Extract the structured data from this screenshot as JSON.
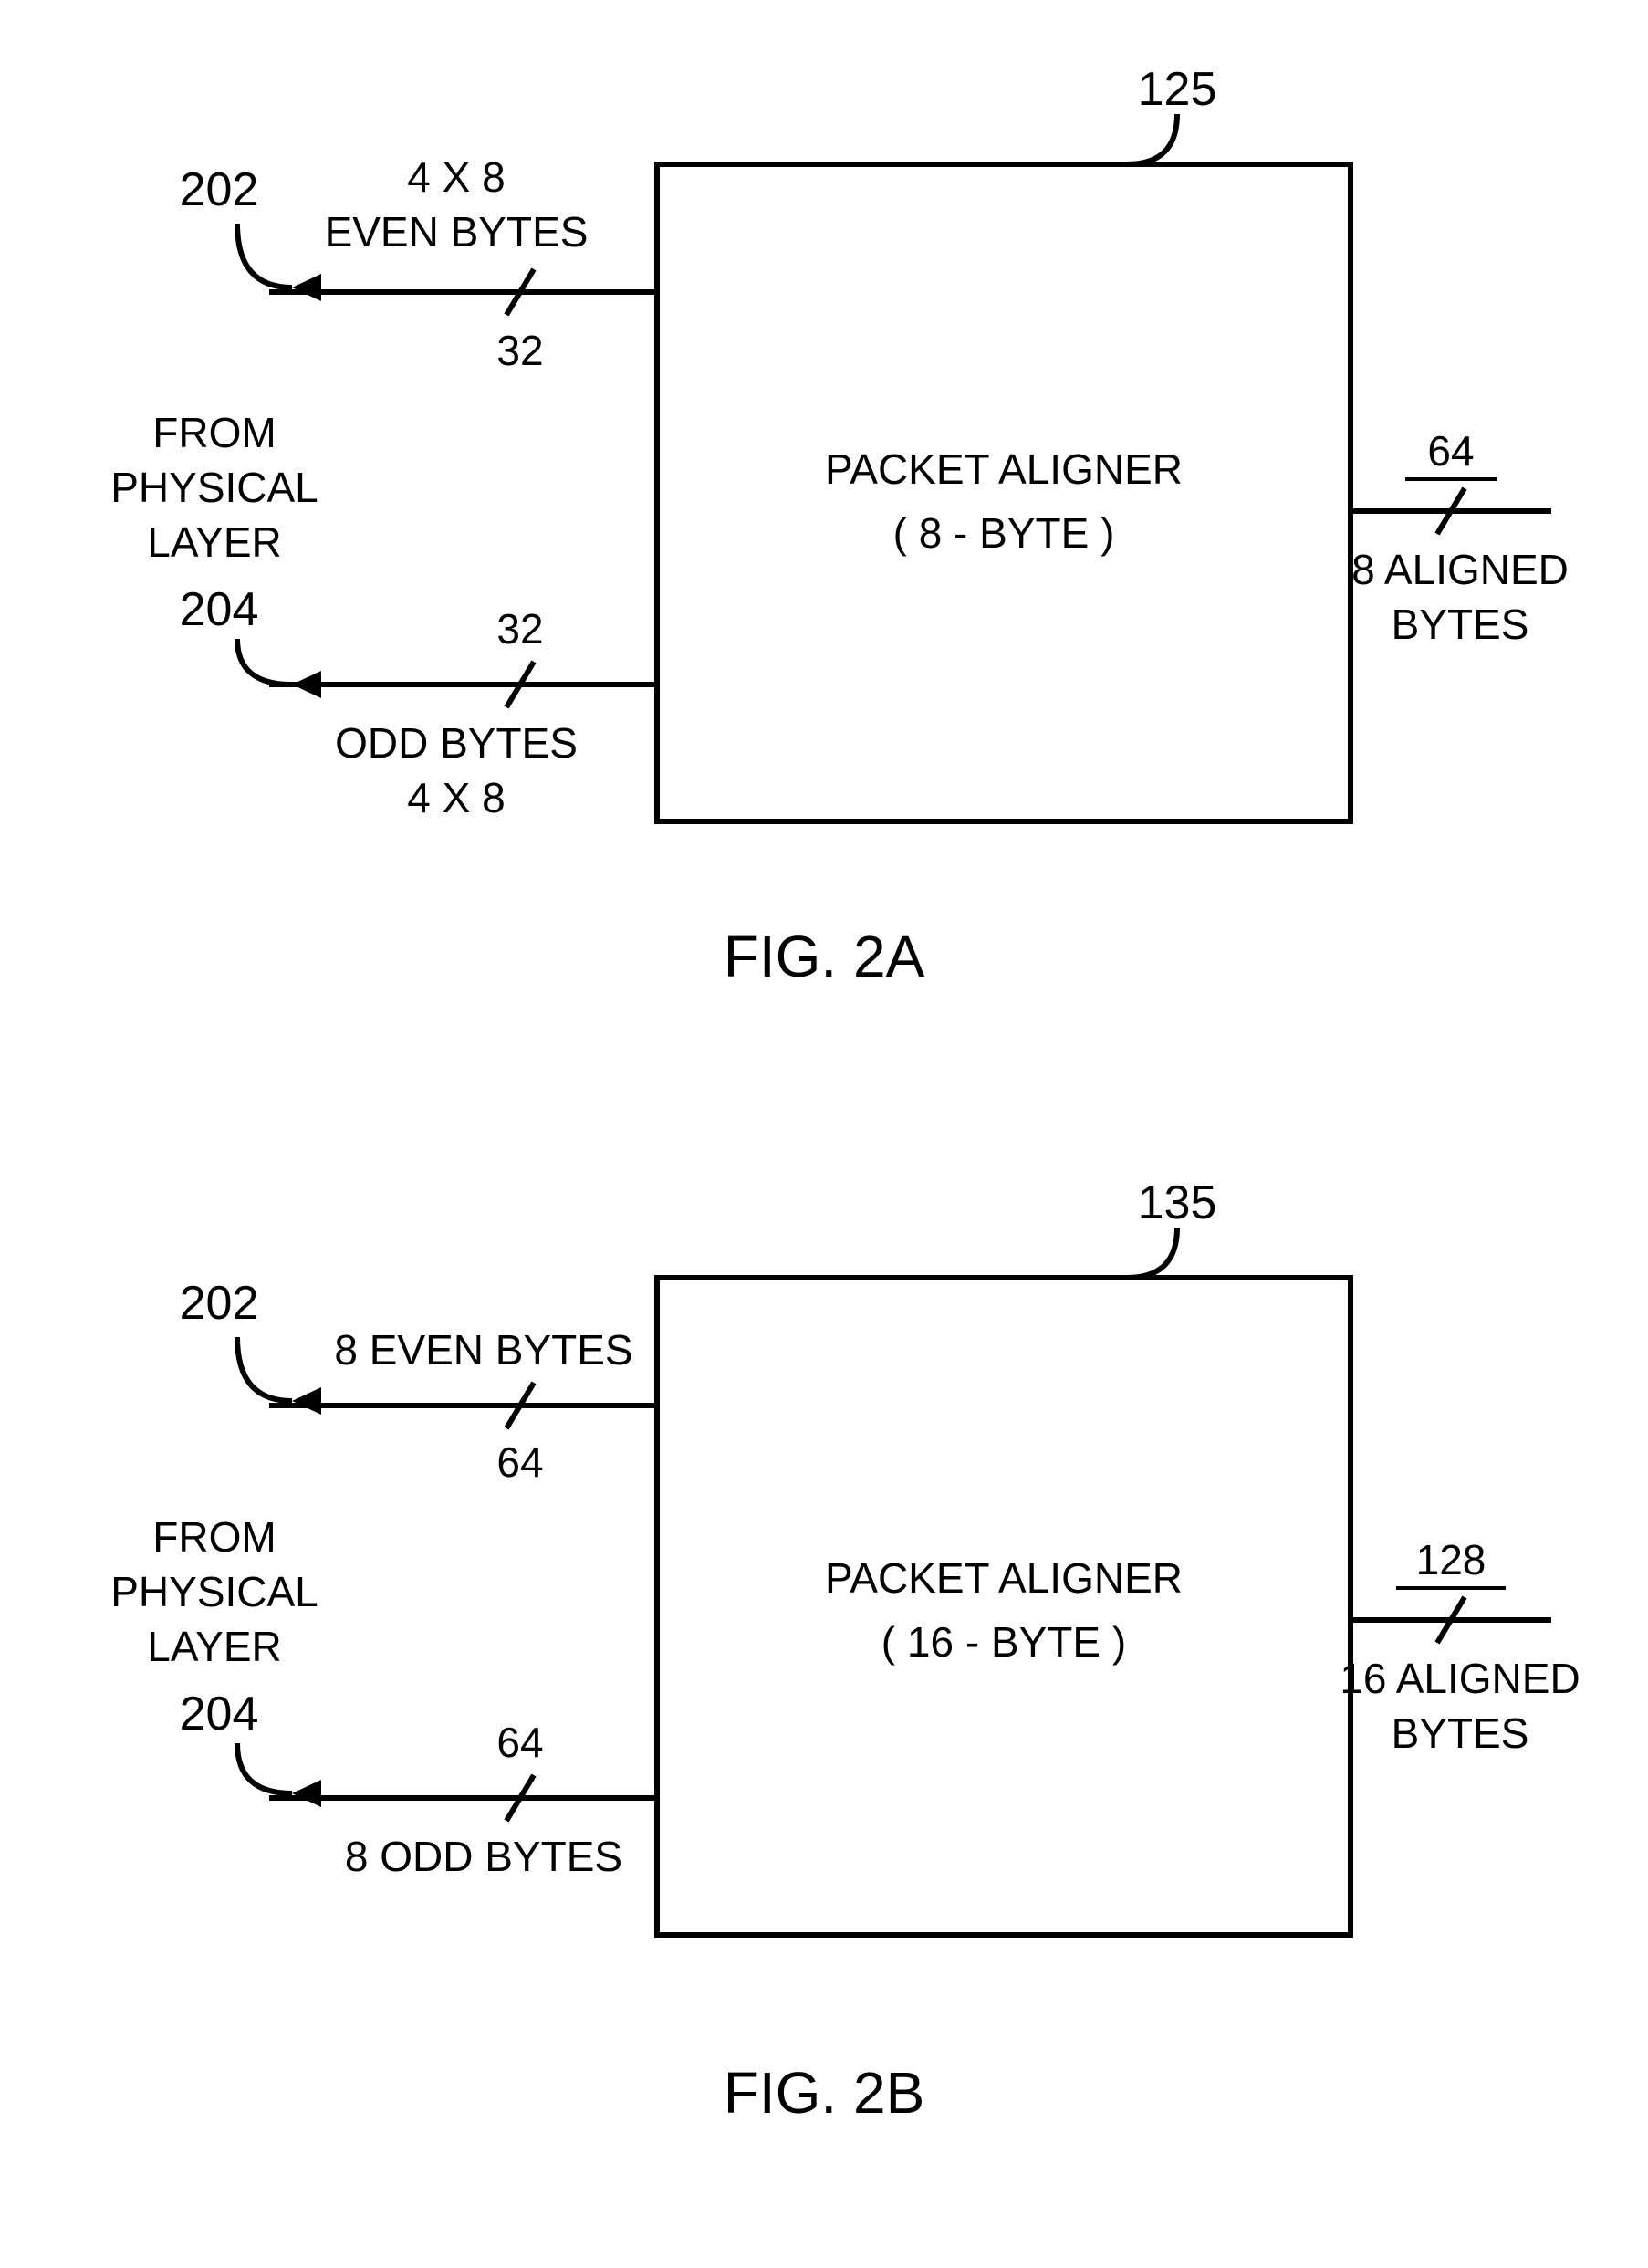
{
  "figA": {
    "caption": "FIG. 2A",
    "block_ref": "125",
    "block_line1": "PACKET ALIGNER",
    "block_line2": "( 8 - BYTE )",
    "source_line1": "FROM",
    "source_line2": "PHYSICAL",
    "source_line3": "LAYER",
    "in1_ref": "202",
    "in1_label1": "4 X 8",
    "in1_label2": "EVEN BYTES",
    "in1_width": "32",
    "in2_ref": "204",
    "in2_label1": "ODD BYTES",
    "in2_label2": "4 X 8",
    "in2_width": "32",
    "out_width": "64",
    "out_label1": "8 ALIGNED",
    "out_label2": "BYTES"
  },
  "figB": {
    "caption": "FIG. 2B",
    "block_ref": "135",
    "block_line1": "PACKET ALIGNER",
    "block_line2": "( 16 - BYTE )",
    "source_line1": "FROM",
    "source_line2": "PHYSICAL",
    "source_line3": "LAYER",
    "in1_ref": "202",
    "in1_label1": "8 EVEN BYTES",
    "in1_width": "64",
    "in2_ref": "204",
    "in2_label1": "8 ODD BYTES",
    "in2_width": "64",
    "out_width": "128",
    "out_label1": "16 ALIGNED",
    "out_label2": "BYTES"
  }
}
